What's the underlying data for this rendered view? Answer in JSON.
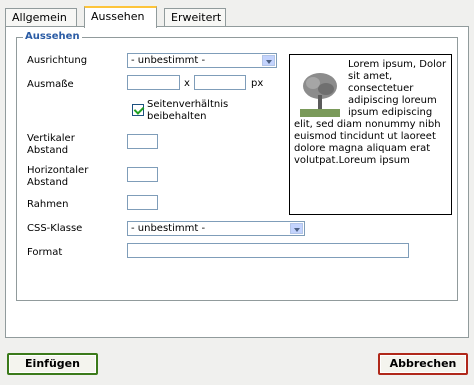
{
  "tabs": [
    "Allgemein",
    "Aussehen",
    "Erweitert"
  ],
  "fieldset": {
    "legend": "Aussehen"
  },
  "fields": {
    "alignment_label": "Ausrichtung",
    "alignment_value": "- unbestimmt -",
    "dimensions_label": "Ausmaße",
    "dimensions_times": "x",
    "dimensions_unit": "px",
    "keep_ratio_line1": "Seitenverhältnis",
    "keep_ratio_line2": "beibehalten",
    "vspace_line1": "Vertikaler",
    "vspace_line2": "Abstand",
    "hspace_line1": "Horizontaler",
    "hspace_line2": "Abstand",
    "border_label": "Rahmen",
    "css_label": "CSS-Klasse",
    "css_value": "- unbestimmt -",
    "format_label": "Format"
  },
  "preview": {
    "text": "Lorem ipsum, Dolor sit amet, consectetuer adipiscing loreum ipsum edipiscing elit, sed diam nonummy nibh euismod tincidunt ut laoreet dolore magna aliquam erat volutpat.Loreum ipsum"
  },
  "buttons": {
    "insert": "Einfügen",
    "cancel": "Abbrechen"
  },
  "state": {
    "keep_ratio_checked": true
  },
  "colors": {
    "legend": "#2b5ca5",
    "insert_border": "#3b7a1a",
    "cancel_border": "#b0281a",
    "active_tab_top": "#fdc43a"
  }
}
